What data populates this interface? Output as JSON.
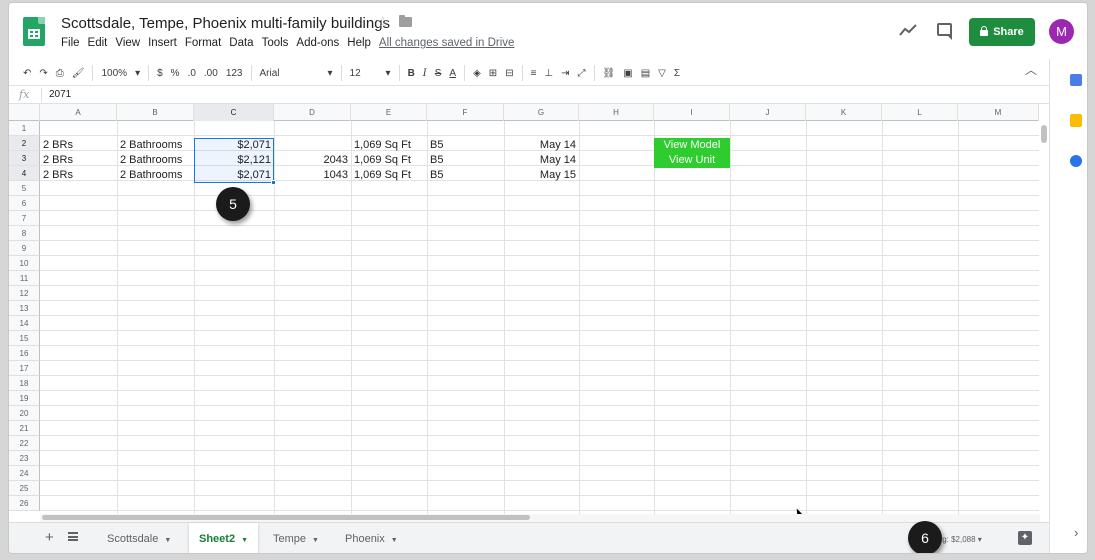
{
  "doc": {
    "title": "Scottsdale, Tempe, Phoenix multi-family buildings",
    "menu": [
      "File",
      "Edit",
      "View",
      "Insert",
      "Format",
      "Data",
      "Tools",
      "Add-ons",
      "Help"
    ],
    "saved_status": "All changes saved in Drive",
    "share_label": "Share",
    "avatar_initial": "M"
  },
  "toolbar": {
    "zoom": "100%",
    "currency": "$",
    "percent": "%",
    "dec_less": ".0",
    "dec_more": ".00",
    "format_more": "123",
    "font": "Arial",
    "font_size": "12",
    "bold": "B",
    "italic": "I",
    "strike": "S",
    "text_color": "A",
    "sum": "Σ"
  },
  "formula_bar": {
    "fx": "fx",
    "value": "2071"
  },
  "grid": {
    "columns": [
      "A",
      "B",
      "C",
      "D",
      "E",
      "F",
      "G",
      "H",
      "I",
      "J",
      "K",
      "L",
      "M"
    ],
    "selected_column": "C",
    "rows": [
      "1",
      "2",
      "3",
      "4",
      "5",
      "6",
      "7",
      "8",
      "9",
      "10",
      "11",
      "12",
      "13",
      "14",
      "15",
      "16",
      "17",
      "18",
      "19",
      "20",
      "21",
      "22",
      "23",
      "24",
      "25",
      "26"
    ],
    "data": [
      {
        "a": "2 BRs",
        "b": "2 Bathrooms",
        "c": "$2,071",
        "d": "",
        "e": "1,069 Sq Ft",
        "f": "B5",
        "g": "May 14"
      },
      {
        "a": "2 BRs",
        "b": "2 Bathrooms",
        "c": "$2,121",
        "d": "2043",
        "e": "1,069 Sq Ft",
        "f": "B5",
        "g": "May 14"
      },
      {
        "a": "2 BRs",
        "b": "2 Bathrooms",
        "c": "$2,071",
        "d": "1043",
        "e": "1,069 Sq Ft",
        "f": "B5",
        "g": "May 15"
      }
    ],
    "buttons": [
      "View Model",
      "View Unit"
    ]
  },
  "markers": {
    "m5": "5",
    "m6": "6"
  },
  "sheets": {
    "tabs": [
      "Scottsdale",
      "Sheet2",
      "Tempe",
      "Phoenix"
    ],
    "active": "Sheet2",
    "explore": "Avg: $2,088"
  },
  "colors": {
    "accent_green": "#1e8e3e",
    "selection": "#1a73e8",
    "button_green": "#2ecc2e"
  }
}
